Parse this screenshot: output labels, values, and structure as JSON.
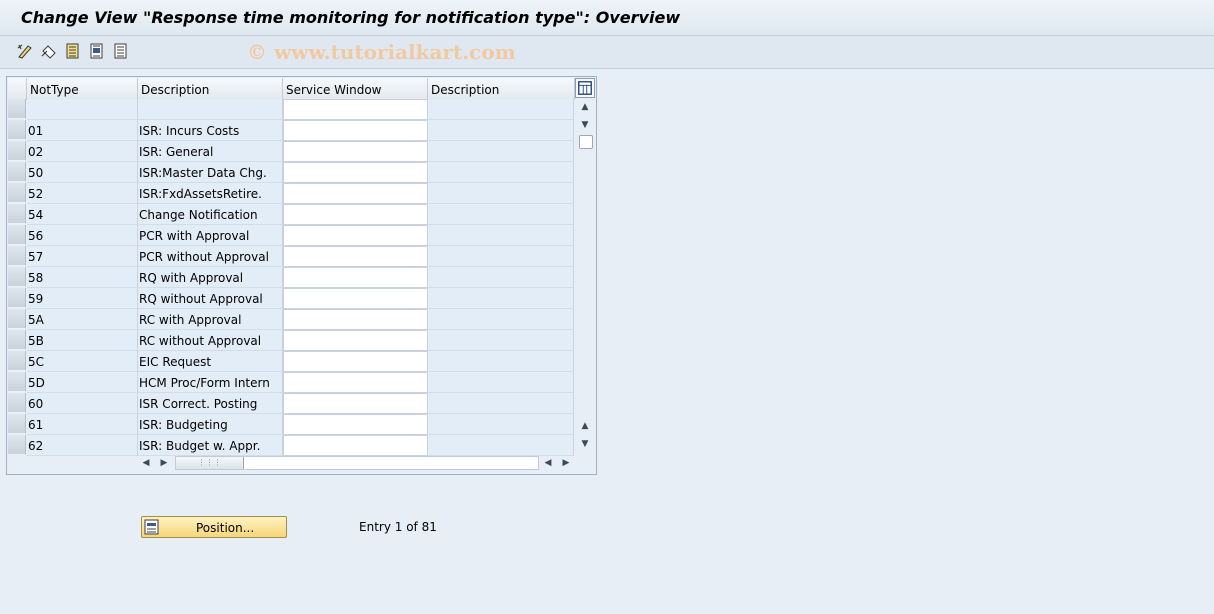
{
  "window": {
    "title": "Change View \"Response time monitoring for notification type\": Overview"
  },
  "toolbar": {
    "watermark": "© www.tutorialkart.com",
    "icons": [
      "change-display-icon",
      "undo-icon",
      "select-all-icon",
      "select-block-icon",
      "deselect-all-icon"
    ]
  },
  "table": {
    "columns": [
      "NotType",
      "Description",
      "Service Window",
      "Description"
    ],
    "rows": [
      {
        "type": "",
        "desc": "",
        "svc": "",
        "desc2": ""
      },
      {
        "type": "01",
        "desc": "ISR: Incurs Costs",
        "svc": "",
        "desc2": ""
      },
      {
        "type": "02",
        "desc": "ISR: General",
        "svc": "",
        "desc2": ""
      },
      {
        "type": "50",
        "desc": "ISR:Master Data Chg.",
        "svc": "",
        "desc2": ""
      },
      {
        "type": "52",
        "desc": "ISR:FxdAssetsRetire.",
        "svc": "",
        "desc2": ""
      },
      {
        "type": "54",
        "desc": "Change Notification",
        "svc": "",
        "desc2": ""
      },
      {
        "type": "56",
        "desc": "PCR with Approval",
        "svc": "",
        "desc2": ""
      },
      {
        "type": "57",
        "desc": "PCR without Approval",
        "svc": "",
        "desc2": ""
      },
      {
        "type": "58",
        "desc": "RQ with Approval",
        "svc": "",
        "desc2": ""
      },
      {
        "type": "59",
        "desc": "RQ without Approval",
        "svc": "",
        "desc2": ""
      },
      {
        "type": "5A",
        "desc": "RC with Approval",
        "svc": "",
        "desc2": ""
      },
      {
        "type": "5B",
        "desc": "RC without Approval",
        "svc": "",
        "desc2": ""
      },
      {
        "type": "5C",
        "desc": "EIC Request",
        "svc": "",
        "desc2": ""
      },
      {
        "type": "5D",
        "desc": "HCM Proc/Form Intern",
        "svc": "",
        "desc2": ""
      },
      {
        "type": "60",
        "desc": "ISR Correct. Posting",
        "svc": "",
        "desc2": ""
      },
      {
        "type": "61",
        "desc": "ISR: Budgeting",
        "svc": "",
        "desc2": ""
      },
      {
        "type": "62",
        "desc": "ISR: Budget w. Appr.",
        "svc": "",
        "desc2": ""
      }
    ]
  },
  "footer": {
    "position_label": "Position...",
    "entry_text": "Entry 1 of 81"
  }
}
